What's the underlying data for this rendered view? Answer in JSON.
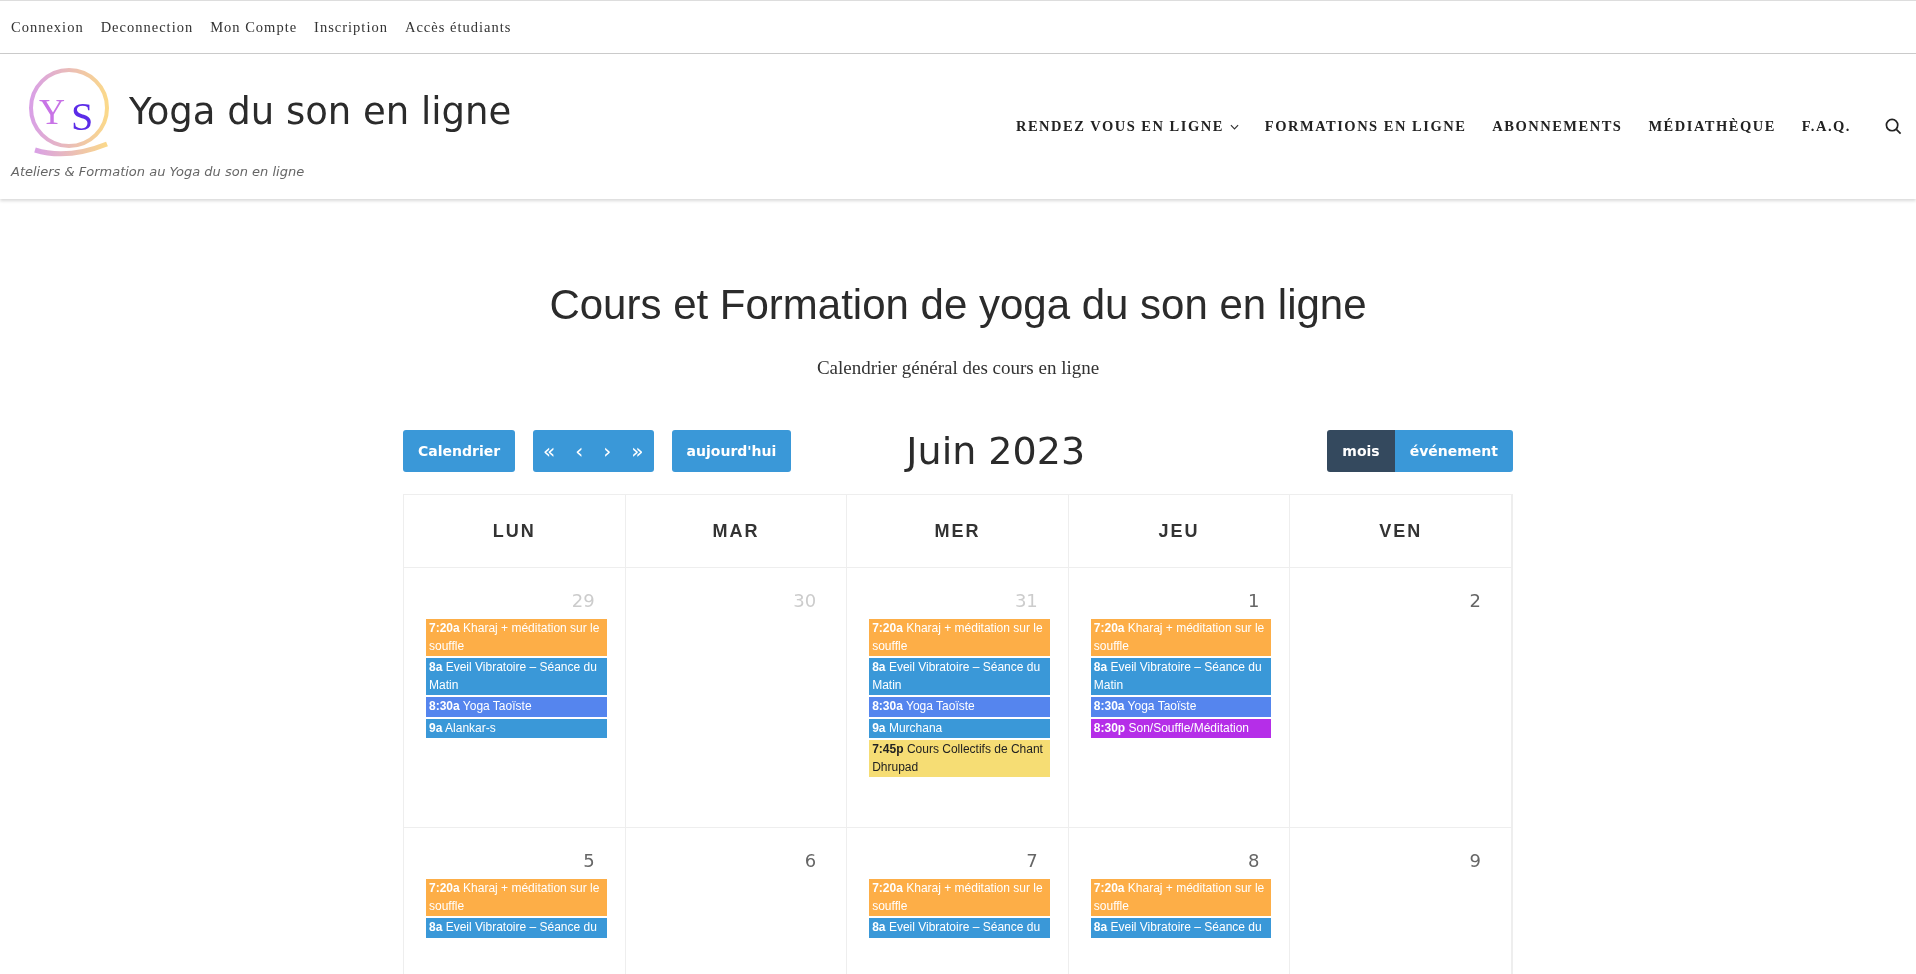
{
  "top_links": [
    "Connexion",
    "Deconnection",
    "Mon Compte",
    "Inscription",
    "Accès étudiants"
  ],
  "site": {
    "logo_letters": [
      "Y",
      "S"
    ],
    "title": "Yoga du son en ligne",
    "tagline": "Ateliers & Formation au Yoga du son en ligne"
  },
  "nav": [
    {
      "label": "RENDEZ VOUS EN LIGNE",
      "has_dropdown": true
    },
    {
      "label": "FORMATIONS EN LIGNE",
      "has_dropdown": false
    },
    {
      "label": "ABONNEMENTS",
      "has_dropdown": false
    },
    {
      "label": "MÉDIATHÈQUE",
      "has_dropdown": false
    },
    {
      "label": "F.A.Q.",
      "has_dropdown": false
    }
  ],
  "page_title": "Cours et Formation de yoga du son en ligne",
  "page_subtitle": "Calendrier général des cours en ligne",
  "calendar": {
    "toolbar_left": [
      {
        "kind": "button",
        "label": "Calendrier"
      },
      {
        "kind": "group",
        "labels": [
          "«",
          "‹",
          "›",
          "»"
        ]
      },
      {
        "kind": "button",
        "label": "aujourd'hui"
      }
    ],
    "month_title": "Juin 2023",
    "views": [
      {
        "label": "mois",
        "selected": true
      },
      {
        "label": "événement",
        "selected": false
      }
    ],
    "weekdays": [
      "LUN",
      "MAR",
      "MER",
      "JEU",
      "VEN"
    ],
    "weeks": [
      [
        {
          "day": "29",
          "other_month": true,
          "events": [
            {
              "time": "7:20a",
              "title": "Kharaj + méditation sur le souffle",
              "color": "#fdae47"
            },
            {
              "time": "8a",
              "title": "Eveil Vibratoire – Séance du Matin",
              "color": "#3a98d8"
            },
            {
              "time": "8:30a",
              "title": "Yoga Taoïste",
              "color": "#5585ee"
            },
            {
              "time": "9a",
              "title": "Alankar-s",
              "color": "#3a98d8"
            }
          ]
        },
        {
          "day": "30",
          "other_month": true
        },
        {
          "day": "31",
          "other_month": true,
          "events": [
            {
              "time": "7:20a",
              "title": "Kharaj + méditation sur le souffle",
              "color": "#fdae47"
            },
            {
              "time": "8a",
              "title": "Eveil Vibratoire – Séance du Matin",
              "color": "#3a98d8"
            },
            {
              "time": "8:30a",
              "title": "Yoga Taoïste",
              "color": "#5585ee"
            },
            {
              "time": "9a",
              "title": "Murchana",
              "color": "#3a98d8"
            },
            {
              "time": "7:45p",
              "title": "Cours Collectifs de Chant Dhrupad",
              "color": "#f6dd74"
            }
          ]
        },
        {
          "day": "1",
          "other_month": false,
          "events": [
            {
              "time": "7:20a",
              "title": "Kharaj + méditation sur le souffle",
              "color": "#fdae47"
            },
            {
              "time": "8a",
              "title": "Eveil Vibratoire – Séance du Matin",
              "color": "#3a98d8"
            },
            {
              "time": "8:30a",
              "title": "Yoga Taoïste",
              "color": "#5585ee"
            },
            {
              "time": "8:30p",
              "title": "Son/Souffle/Méditation",
              "color": "#b52ee8"
            }
          ]
        },
        {
          "day": "2",
          "other_month": false
        }
      ],
      [
        {
          "day": "5",
          "other_month": false,
          "events": [
            {
              "time": "7:20a",
              "title": "Kharaj + méditation sur le souffle",
              "color": "#fdae47"
            },
            {
              "time": "8a",
              "title": "Eveil Vibratoire – Séance du",
              "color": "#3a98d8"
            }
          ]
        },
        {
          "day": "6",
          "other_month": false
        },
        {
          "day": "7",
          "other_month": false,
          "events": [
            {
              "time": "7:20a",
              "title": "Kharaj + méditation sur le souffle",
              "color": "#fdae47"
            },
            {
              "time": "8a",
              "title": "Eveil Vibratoire – Séance du",
              "color": "#3a98d8"
            }
          ]
        },
        {
          "day": "8",
          "other_month": false,
          "events": [
            {
              "time": "7:20a",
              "title": "Kharaj + méditation sur le souffle",
              "color": "#fdae47"
            },
            {
              "time": "8a",
              "title": "Eveil Vibratoire – Séance du",
              "color": "#3a98d8"
            }
          ]
        },
        {
          "day": "9",
          "other_month": false
        }
      ]
    ]
  }
}
